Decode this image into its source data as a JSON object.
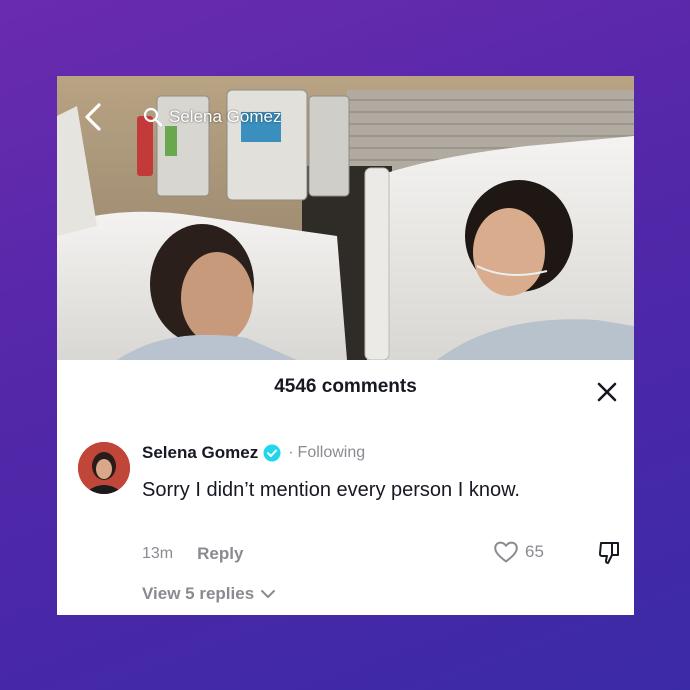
{
  "search": {
    "query": "Selena Gomez"
  },
  "comments_panel": {
    "count_label": "4546 comments"
  },
  "comment": {
    "username": "Selena Gomez",
    "separator": "·",
    "follow_status": "Following",
    "text": "Sorry I didn’t mention every person I know.",
    "timestamp": "13m",
    "reply_label": "Reply",
    "like_count": "65",
    "view_replies_label": "View 5 replies"
  },
  "icons": {
    "back": "chevron-left-icon",
    "search": "search-icon",
    "close": "close-icon",
    "verified": "verified-badge-icon",
    "like": "heart-icon",
    "dislike": "thumbs-down-icon",
    "expand": "chevron-down-icon"
  },
  "colors": {
    "background_gradient_start": "#6a2bb0",
    "background_gradient_end": "#3b2aa6",
    "verified_blue": "#20d5ec",
    "text_primary": "#161823",
    "text_secondary": "#8a8b91"
  }
}
